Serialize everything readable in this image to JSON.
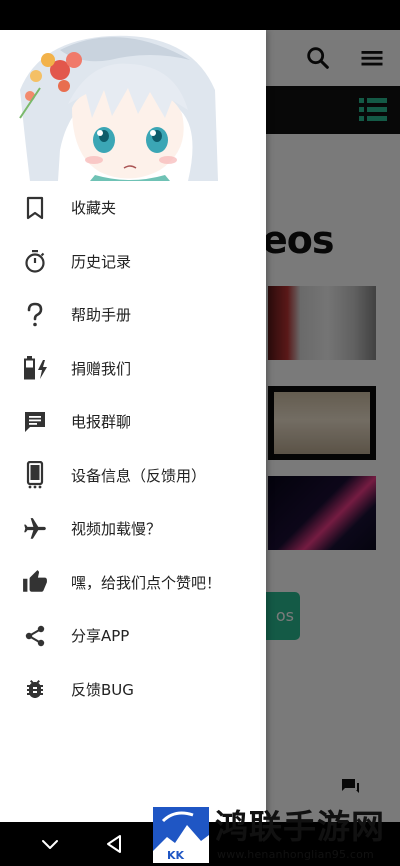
{
  "app": {
    "heading_partial": "eos",
    "button_partial": "os"
  },
  "drawer": {
    "menu": [
      {
        "icon": "bookmark-icon",
        "label": "收藏夹"
      },
      {
        "icon": "timer-icon",
        "label": "历史记录"
      },
      {
        "icon": "help-icon",
        "label": "帮助手册"
      },
      {
        "icon": "battery-charging-icon",
        "label": "捐赠我们"
      },
      {
        "icon": "message-icon",
        "label": "电报群聊"
      },
      {
        "icon": "phone-info-icon",
        "label": "设备信息（反馈用）"
      },
      {
        "icon": "airplane-icon",
        "label": "视频加载慢？"
      },
      {
        "icon": "thumb-up-icon",
        "label": "嘿，给我们点个赞吧！"
      },
      {
        "icon": "share-icon",
        "label": "分享APP"
      },
      {
        "icon": "bug-icon",
        "label": "反馈BUG"
      }
    ]
  },
  "watermark": {
    "title": "鸿联手游网",
    "url": "www.henanhonglian95.com"
  },
  "colors": {
    "icon": "#333333",
    "accent": "#2bbd92",
    "tab_icon": "#2bbd92",
    "watermark_blue": "#1f56c4"
  }
}
